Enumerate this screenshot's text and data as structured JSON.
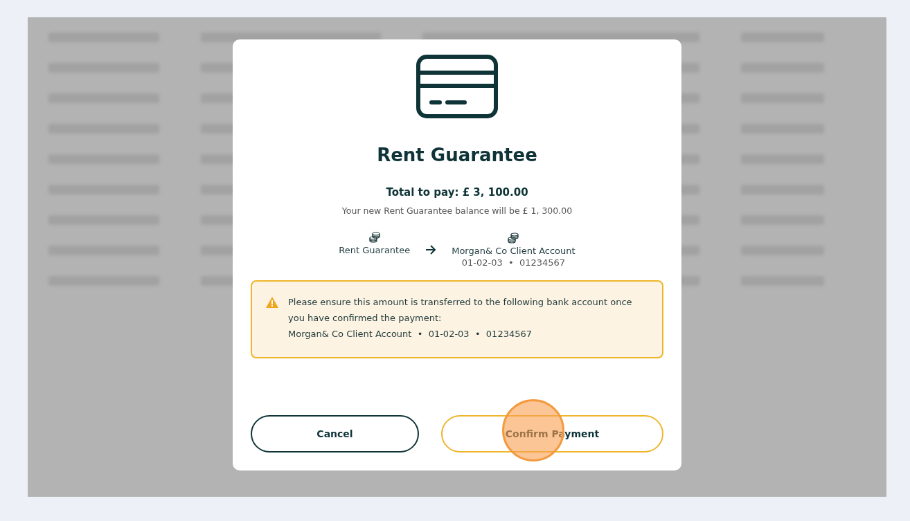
{
  "dialog": {
    "title": "Rent Guarantee",
    "total": "Total to pay: £ 3, 100.00",
    "balance_note": "Your new Rent Guarantee balance will be £ 1, 300.00",
    "transfer": {
      "from": {
        "name": "Rent Guarantee"
      },
      "to": {
        "name": "Morgan& Co Client Account",
        "details": "01-02-03  •  01234567"
      }
    },
    "warning": {
      "message": "Please ensure this amount is transferred to the following bank account once you have confirmed the payment:",
      "account_details": "Morgan& Co Client Account  •  01-02-03  •  01234567"
    },
    "buttons": [
      {
        "label": "Cancel",
        "kind": "secondary"
      },
      {
        "label": "Confirm Payment",
        "kind": "primary",
        "clicked": true
      }
    ]
  }
}
